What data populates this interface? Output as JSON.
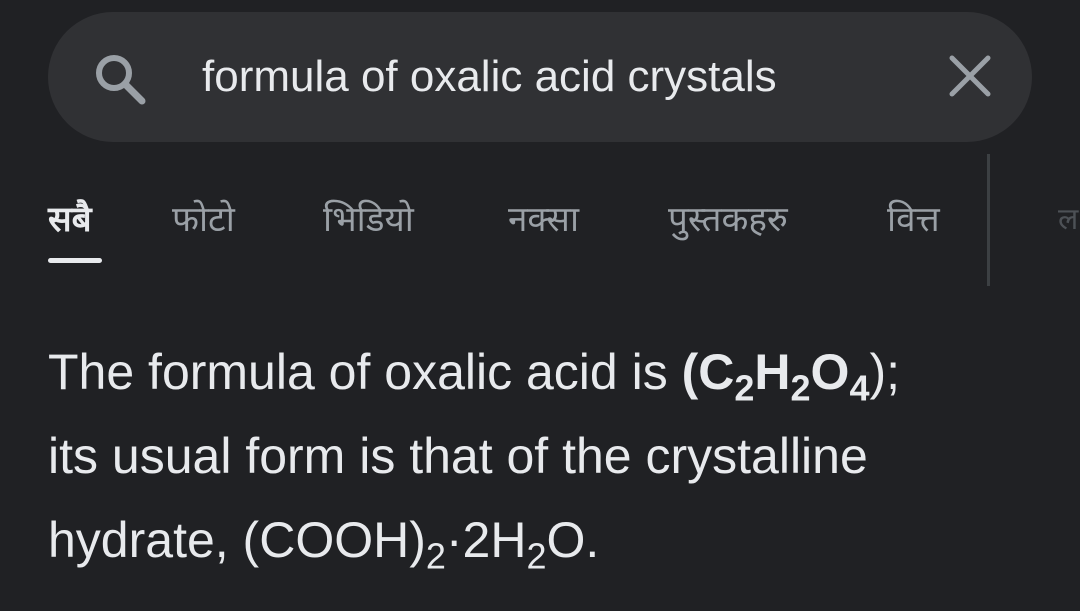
{
  "search": {
    "query": "formula of oxalic acid crystals",
    "search_icon": "search-icon",
    "clear_icon": "close-icon"
  },
  "tabs": [
    {
      "label": "सबै",
      "active": true
    },
    {
      "label": "फोटो",
      "active": false
    },
    {
      "label": "भिडियो",
      "active": false
    },
    {
      "label": "नक्सा",
      "active": false
    },
    {
      "label": "पुस्तकहरु",
      "active": false
    },
    {
      "label": "वित्त",
      "active": false
    },
    {
      "label": "ल",
      "active": false
    }
  ],
  "answer": {
    "line1_prefix": "The formula of oxalic acid is ",
    "formula_open": "(",
    "formula_c": "C",
    "formula_c_sub": "2",
    "formula_h": "H",
    "formula_h_sub": "2",
    "formula_o": "O",
    "formula_o_sub": "4",
    "formula_close": ")",
    "line1_suffix": ";",
    "line2": "its usual form is that of the crystalline",
    "line3_prefix": "hydrate, (COOH)",
    "line3_sub1": "2",
    "line3_middle": "·2H",
    "line3_sub2": "2",
    "line3_suffix": "O."
  },
  "colors": {
    "background": "#202124",
    "search_background": "#303134",
    "active_text": "#e8eaed",
    "inactive_text": "#9aa0a6",
    "divider": "#3c4043"
  }
}
